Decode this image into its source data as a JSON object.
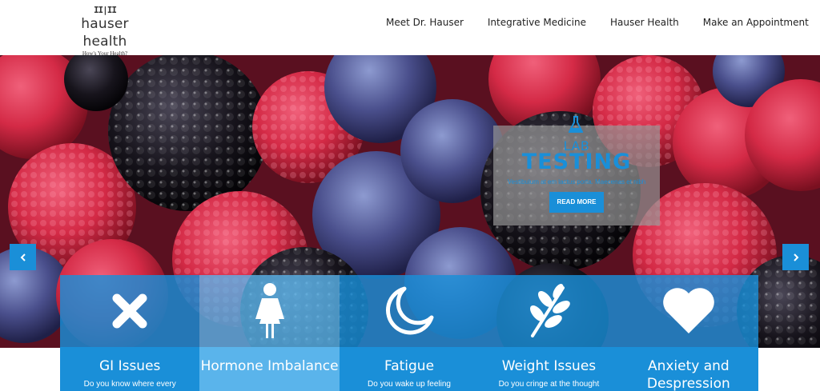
{
  "brand": {
    "mark": "II|II",
    "name": "hauser health",
    "tagline": "How's Your Health?"
  },
  "nav": {
    "items": [
      "Meet Dr. Hauser",
      "Integrative Medicine",
      "Hauser Health",
      "Make an Appointment"
    ]
  },
  "slide": {
    "icon": "flask-icon",
    "heading_small": "LAB",
    "heading_big": "TESTING",
    "text": "Vestibulum at em lactus porta. Maecenas et nibh",
    "button": "READ MORE"
  },
  "carousel": {
    "prev_icon": "chevron-left-icon",
    "next_icon": "chevron-right-icon"
  },
  "services": [
    {
      "icon": "cross-icon",
      "title": "GI Issues",
      "desc": "Do you know where every"
    },
    {
      "icon": "woman-icon",
      "title": "Hormone Imbalance",
      "desc": ""
    },
    {
      "icon": "moon-icon",
      "title": "Fatigue",
      "desc": "Do you wake up feeling"
    },
    {
      "icon": "leaf-icon",
      "title": "Weight Issues",
      "desc": "Do you cringe at the thought"
    },
    {
      "icon": "heart-icon",
      "title": "Anxiety and Despression",
      "desc": ""
    }
  ],
  "colors": {
    "accent": "#1a8fd8",
    "accent_light": "#5ab4eb"
  }
}
